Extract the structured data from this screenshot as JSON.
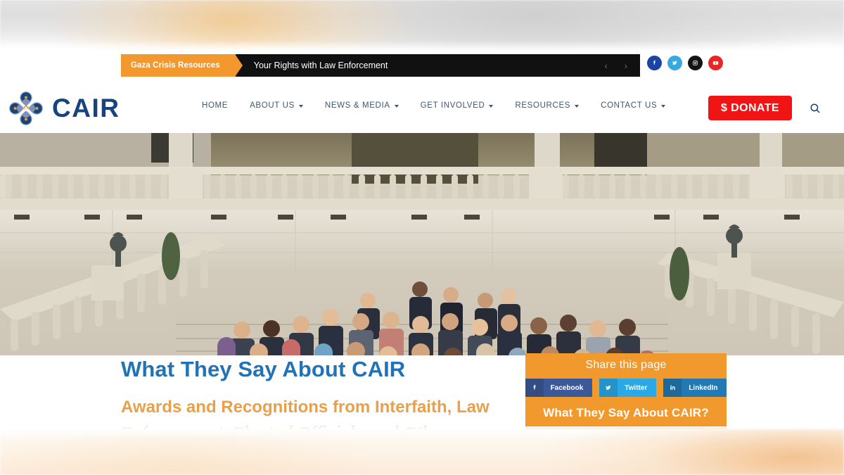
{
  "ticker": {
    "tag_label": "Gaza Crisis Resources",
    "headline": "Your Rights with Law Enforcement",
    "prev_arrow": "‹",
    "next_arrow": "›"
  },
  "socials": [
    {
      "name": "facebook",
      "label": "Facebook",
      "color": "#1b44a6"
    },
    {
      "name": "twitter",
      "label": "Twitter",
      "color": "#38a8e0"
    },
    {
      "name": "instagram",
      "label": "Instagram",
      "color": "#141414"
    },
    {
      "name": "youtube",
      "label": "YouTube",
      "color": "#ea2526"
    }
  ],
  "brand": {
    "name": "CAIR",
    "logo_icon": "cair-quatrefoil-logo",
    "text_color": "#17447e",
    "accent_color": "#f2992e"
  },
  "nav": {
    "items": [
      {
        "label": "HOME",
        "has_dropdown": false
      },
      {
        "label": "ABOUT US",
        "has_dropdown": true
      },
      {
        "label": "NEWS & MEDIA",
        "has_dropdown": true
      },
      {
        "label": "GET INVOLVED",
        "has_dropdown": true
      },
      {
        "label": "RESOURCES",
        "has_dropdown": true
      },
      {
        "label": "CONTACT US",
        "has_dropdown": true
      }
    ],
    "donate_label": "$ DONATE",
    "donate_color": "#f01414",
    "search_icon": "search-icon"
  },
  "hero": {
    "alt": "Large group photo of CAIR staff and delegates standing on stone steps in front of a building with a balustrade"
  },
  "main": {
    "title": "What They Say About CAIR",
    "title_color": "#2273b5",
    "subtitle": "Awards and Recognitions from Interfaith, Law Enforcement, Elected Officials and Others",
    "subtitle_color": "#e8a04a"
  },
  "share": {
    "heading": "Share this page",
    "panel_color": "#f2992e",
    "buttons": [
      {
        "label": "Facebook",
        "icon": "facebook-icon",
        "color": "#3b5998"
      },
      {
        "label": "Twitter",
        "icon": "twitter-icon",
        "color": "#2aa9e8"
      },
      {
        "label": "LinkedIn",
        "icon": "linkedin-icon",
        "color": "#2279b3"
      }
    ],
    "subheading": "What They Say About CAIR?"
  }
}
